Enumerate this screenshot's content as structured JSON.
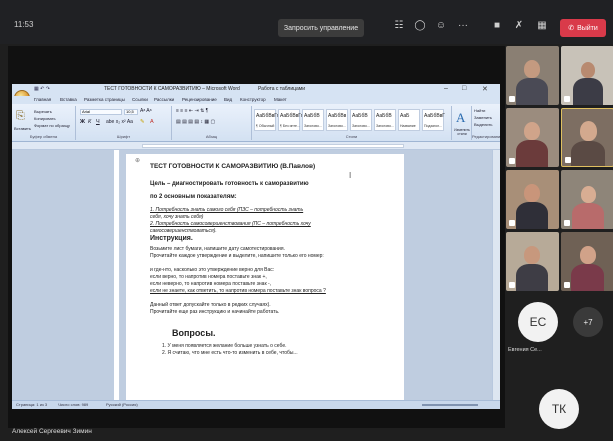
{
  "meeting": {
    "time": "11:53",
    "request_control_label": "Запросить управление",
    "exit_label": "Выйти",
    "presenter_name": "Алексей Сергеевич Зимин",
    "toolbar_icons": [
      "participants-icon",
      "chat-icon",
      "reactions-icon",
      "more-icon",
      "camera-off-icon",
      "mic-off-icon",
      "layout-icon",
      "phone-icon"
    ]
  },
  "word": {
    "window_title": "ТЕСТ ГОТОВНОСТИ К САМОРАЗВИТИЮ – Microsoft Word",
    "context_title": "Работа с таблицами",
    "tabs": [
      "Главная",
      "Вставка",
      "Разметка страницы",
      "Ссылки",
      "Рассылки",
      "Рецензирование",
      "Вид",
      "Конструктор",
      "Макет"
    ],
    "font_name": "Arial",
    "font_size": "10,5",
    "paste_label": "Вставить",
    "clipboard_items": [
      "Вырезать",
      "Копировать",
      "Формат по образцу"
    ],
    "group_labels": [
      "Буфер обмена",
      "Шрифт",
      "Абзац",
      "Стили",
      "Редактирование"
    ],
    "styles": [
      {
        "sample": "АаБбВвГг",
        "name": "¶ Обычный"
      },
      {
        "sample": "АаБбВвГг",
        "name": "¶ Без инте..."
      },
      {
        "sample": "АаБбВ",
        "name": "Заголово..."
      },
      {
        "sample": "АаБбВв",
        "name": "Заголово..."
      },
      {
        "sample": "АаБбВ",
        "name": "Заголово..."
      },
      {
        "sample": "АаБбВ",
        "name": "Заголово..."
      },
      {
        "sample": "АаБ",
        "name": "Название"
      },
      {
        "sample": "АаБбВвГ",
        "name": "Подзагол..."
      }
    ],
    "change_styles_label": "Изменить стили",
    "edit_items": [
      "Найти",
      "Заменить",
      "Выделить"
    ],
    "status": {
      "page": "Страница: 1 из 3",
      "words": "Число слов: 989",
      "language": "Русский (Россия)"
    }
  },
  "document": {
    "title": "ТЕСТ ГОТОВНОСТИ К САМОРАЗВИТИЮ (В.Павлов)",
    "goal": "Цель – диагностировать готовность к саморазвитию",
    "criteria_intro": "по 2 основным показателям:",
    "criteria_1a": "1. Потребность знать самого себя (ПЗС – потребность знать",
    "criteria_1b": "себя, хочу знать себя)",
    "criteria_2a": "2. Потребность самосовершенствования (ПС – потребность хочу",
    "criteria_2b": "самосовершенствоваться).",
    "instruction_heading": "Инструкция.",
    "instr_1": "Возьмите лист бумаги, напишите дату самотестирования.",
    "instr_2": "Прочитайте каждое утверждение и выделите, напишите только его номер:",
    "instr_3": "и где-нто, насколько это утверждение верно для Вас:",
    "instr_4": "если верно, то напротив номера поставьте знак +,",
    "instr_5": "если неверно, то напротив номера поставьте знак -,",
    "instr_6": "если не знаете, как ответить, то напротив номера поставьте знак вопроса ?",
    "instr_7": "Данный ответ допускайте только в редких случаях).",
    "instr_8": "Прочитайте еще раз инструкцию и начинайте работать.",
    "questions_heading": "Вопросы.",
    "q1": "1. У меня появляется желание больше узнать о себе.",
    "q2": "2. Я считаю, что мне есть что-то изменить в себе, чтобы..."
  },
  "participants": {
    "tile_1_initials": "ЕС",
    "tile_1_name": "Евгения Се...",
    "more_count": "+7",
    "tile_2_initials": "ТК"
  },
  "colors": {
    "exit_red": "#d93a4a",
    "word_blue": "#c9d7ea",
    "dark_bg": "#1f1f1f"
  }
}
